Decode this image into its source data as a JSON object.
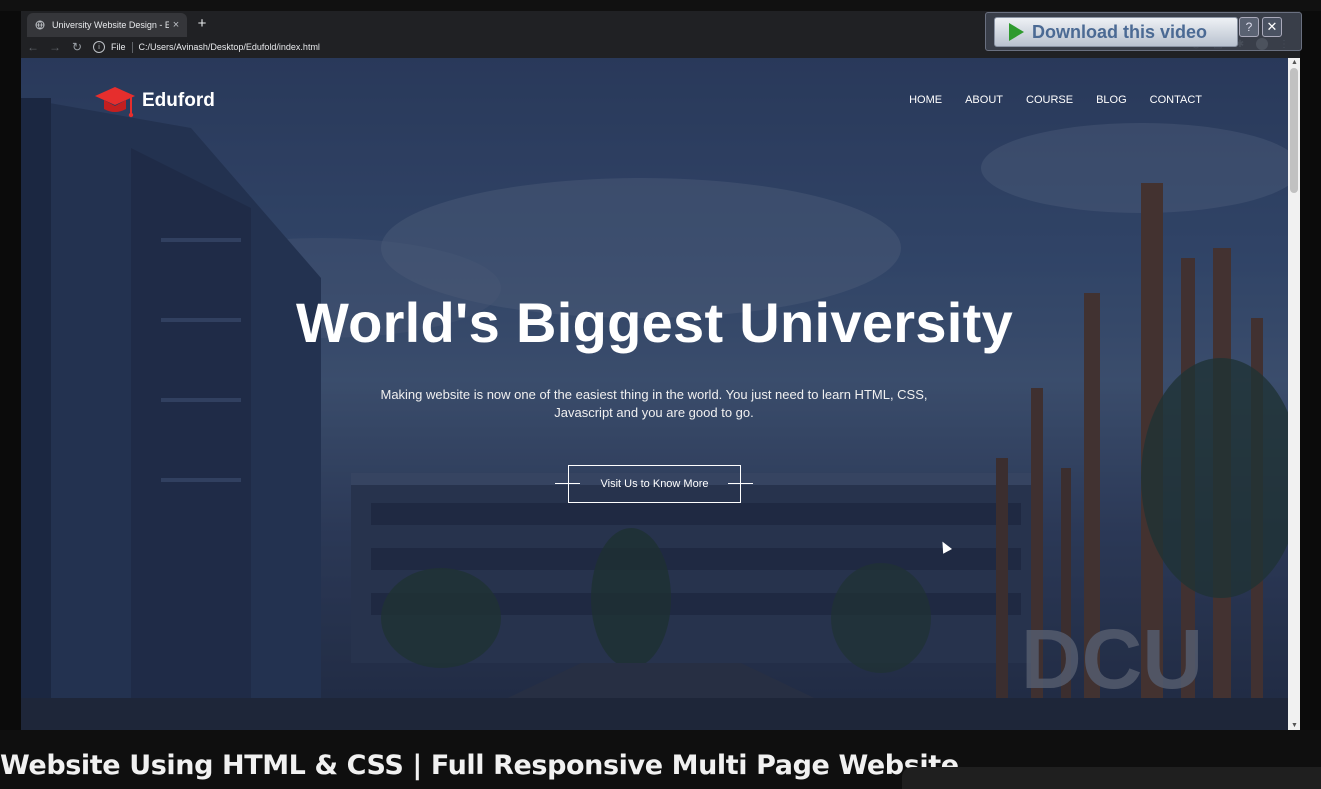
{
  "browser": {
    "tab_title": "University Website Design - Easy",
    "tab_close": "×",
    "new_tab": "+",
    "file_label": "File",
    "url": "C:/Users/Avinash/Desktop/Edufold/index.html"
  },
  "overlay": {
    "download_label": "Download this video",
    "help": "?",
    "close": "✕"
  },
  "site": {
    "logo_text": "Eduford",
    "nav": [
      "HOME",
      "ABOUT",
      "COURSE",
      "BLOG",
      "CONTACT"
    ],
    "hero_title": "World's Biggest University",
    "hero_subtitle": "Making website is now one of the easiest thing in the world. You just need to learn HTML, CSS, Javascript and you are good to go.",
    "cta": "Visit Us to Know More",
    "sign_text": "DCU"
  },
  "video_title": "Website Using HTML & CSS | Full Responsive Multi Page Website",
  "colors": {
    "logo_red": "#e62e2d",
    "chrome_bg": "#202124"
  }
}
